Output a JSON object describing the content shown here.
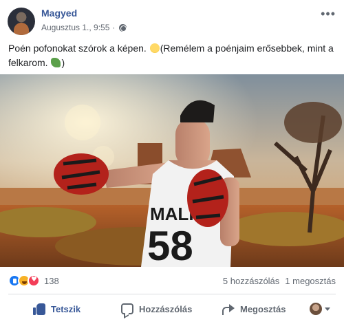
{
  "post": {
    "author": "Magyed",
    "timestamp": "Augusztus 1., 9:55",
    "privacy_icon": "globe-icon",
    "more_label": "•••",
    "text_part1": "Poén pofonokat szórok a képen.",
    "text_part2": "(Remélem a poénjaim erősebbek, mint a felkarom.",
    "text_part3": ")"
  },
  "photo": {
    "singlet_text_top": "MALIE",
    "singlet_number": "58"
  },
  "stats": {
    "reaction_count": "138",
    "comments": "5 hozzászólás",
    "shares": "1 megosztás",
    "reaction_icons": [
      "like-icon",
      "haha-icon",
      "love-icon"
    ]
  },
  "actions": {
    "like_label": "Tetszik",
    "comment_label": "Hozzászólás",
    "share_label": "Megosztás"
  },
  "colors": {
    "link_blue": "#385898",
    "muted": "#606770",
    "divider": "#dadde1"
  }
}
